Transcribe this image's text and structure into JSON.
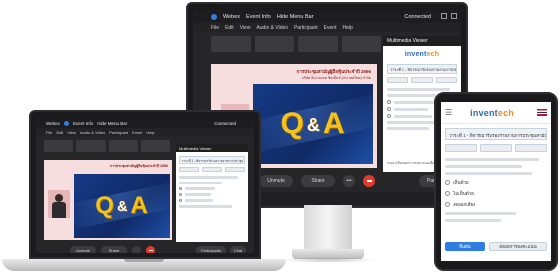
{
  "monitor": {
    "window": {
      "title_items": [
        "Webex",
        "Event Info",
        "Hide Menu Bar"
      ],
      "status": "Connected",
      "menu": [
        "File",
        "Edit",
        "View",
        "Audio & Video",
        "Participant",
        "Event",
        "Help"
      ]
    },
    "slide": {
      "heading": "การประชุมสามัญผู้ถือหุ้นประจำปี 2566",
      "subheading": "บริษัท อินเวนเทค ซิสเต็มส์ (ประเทศไทย) จำกัด",
      "qa_q": "Q",
      "qa_amp": "&",
      "qa_a": "A"
    },
    "controls": {
      "unmute": "Unmute",
      "share": "Share",
      "more": "•••",
      "participants": "Participants"
    },
    "panel": {
      "title": "Multimedia Viewer",
      "logo_main": "invent",
      "logo_accent": "ech",
      "question_header": "วาระที่ 1 - พิจารณารับรองรายงานการประชุมสามัญ...",
      "footer_hint": "กรุณาเลือกผลการลงคะแนนเสียงของท่าน"
    }
  },
  "laptop": {
    "window": {
      "title_items": [
        "Webex",
        "Event Info",
        "Hide Menu Bar"
      ],
      "status": "Connected",
      "menu": [
        "File",
        "Edit",
        "View",
        "Audio & Video",
        "Participant",
        "Event",
        "Help"
      ]
    },
    "slide": {
      "heading": "การประชุมสามัญผู้ถือหุ้นประจำปี 2566",
      "qa_q": "Q",
      "qa_amp": "&",
      "qa_a": "A"
    },
    "controls": {
      "unmute": "Unmute",
      "share": "Share",
      "participants": "Participants",
      "chat": "Chat"
    },
    "panel": {
      "title": "Multimedia Viewer",
      "question_header": "วาระที่ 1 - พิจารณารับรองรายงานการประชุม..."
    }
  },
  "tablet": {
    "logo_main": "invent",
    "logo_accent": "ech",
    "question_header": "วาระที่ 1 - พิจารณารับรองรายงานการประชุมสามัญ...",
    "vote_buttons": [
      "เห็นด้วย",
      "ไม่เห็นด้วย",
      "งดออกเสียง"
    ],
    "confirm": "ยืนยัน",
    "submit": "ส่งผลการลงคะแนน"
  },
  "colors": {
    "accent_blue": "#2f7de1",
    "stop_red": "#e23b2b",
    "qa_gold": "#f5c21b",
    "logo_orange": "#f08a1c"
  }
}
